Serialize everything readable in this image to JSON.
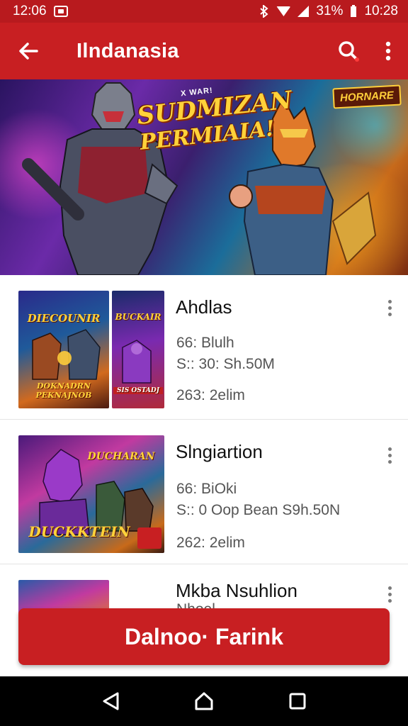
{
  "status_bar": {
    "left_time": "12:06",
    "battery": "31%",
    "clock": "10:28",
    "icons": [
      "message-icon",
      "bluetooth-icon",
      "wifi-icon",
      "signal-icon"
    ]
  },
  "app_bar": {
    "title": "Ilndanasia",
    "icons": [
      "back-arrow-icon",
      "search-icon",
      "more-vert-icon"
    ]
  },
  "banner": {
    "kicker": "X WAR!",
    "title_line1": "SUDMIZAN",
    "title_line2": "PERMIAIA!",
    "logo": "HORNARE"
  },
  "items": [
    {
      "title": "Ahdlas",
      "line1": "66: Blulh",
      "line2": "S:: 30: Sh.50M",
      "line3": "263: 2elim",
      "thumb1_text": "DIECOUNIR",
      "thumb1_sub": "DOKNADRN PEKNAJNOB",
      "thumb2_text": "BUCKAIR",
      "thumb2_sub": "SIS OSTADJ"
    },
    {
      "title": "Slngiartion",
      "line1": "66: BiOki",
      "line2": "S:: 0 Oop Bean S9h.50N",
      "line3": "262: 2elim",
      "thumb1_text": "DUCHARAN",
      "thumb1_sub": "DUCKKTEIN"
    },
    {
      "title": "Mkba Nsuhlion",
      "line1": "Nhoel"
    }
  ],
  "primary_button": {
    "label": "Dalnoo· Farink"
  },
  "colors": {
    "primary": "#c81f22",
    "status": "#b81a1e"
  }
}
